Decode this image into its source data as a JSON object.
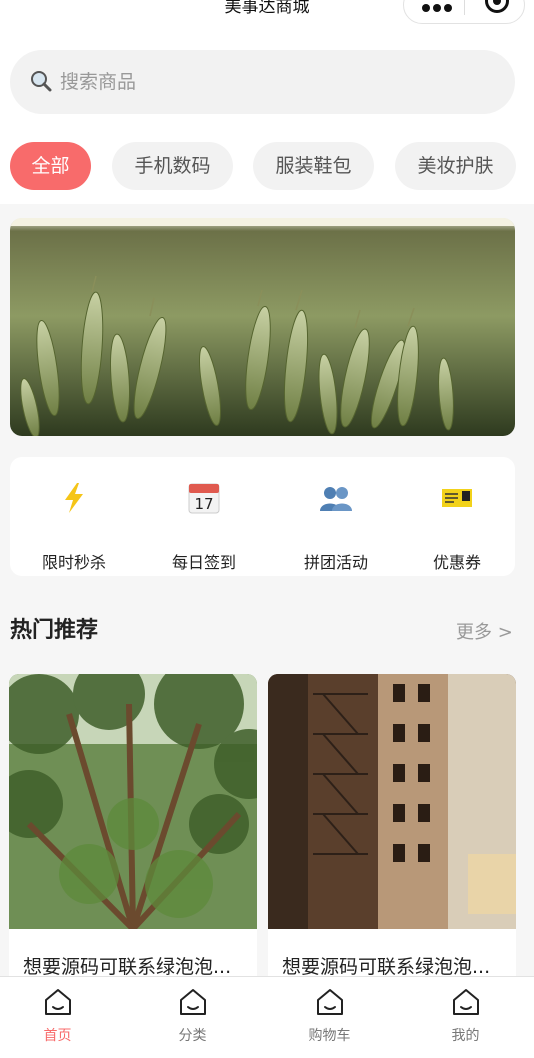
{
  "app": {
    "title": "美事达商城"
  },
  "search": {
    "placeholder": "搜索商品",
    "icon": "search-icon"
  },
  "categories": [
    {
      "label": "全部",
      "active": true
    },
    {
      "label": "手机数码",
      "active": false
    },
    {
      "label": "服装鞋包",
      "active": false
    },
    {
      "label": "美妆护肤",
      "active": false
    }
  ],
  "quick_entries": [
    {
      "label": "限时秒杀",
      "icon": "lightning-icon"
    },
    {
      "label": "每日签到",
      "icon": "calendar-icon",
      "icon_text": "17"
    },
    {
      "label": "拼团活动",
      "icon": "group-icon"
    },
    {
      "label": "优惠券",
      "icon": "ticket-icon"
    }
  ],
  "section": {
    "title": "热门推荐",
    "more": "更多 >"
  },
  "products": [
    {
      "title": "想要源码可联系绿泡泡..."
    },
    {
      "title": "想要源码可联系绿泡泡..."
    }
  ],
  "tabbar": [
    {
      "label": "首页",
      "icon": "home-icon",
      "active": true
    },
    {
      "label": "分类",
      "icon": "category-icon",
      "active": false
    },
    {
      "label": "购物车",
      "icon": "cart-icon",
      "active": false
    },
    {
      "label": "我的",
      "icon": "profile-icon",
      "active": false
    }
  ],
  "colors": {
    "accent": "#f86b6b",
    "background": "#f6f6f6"
  }
}
